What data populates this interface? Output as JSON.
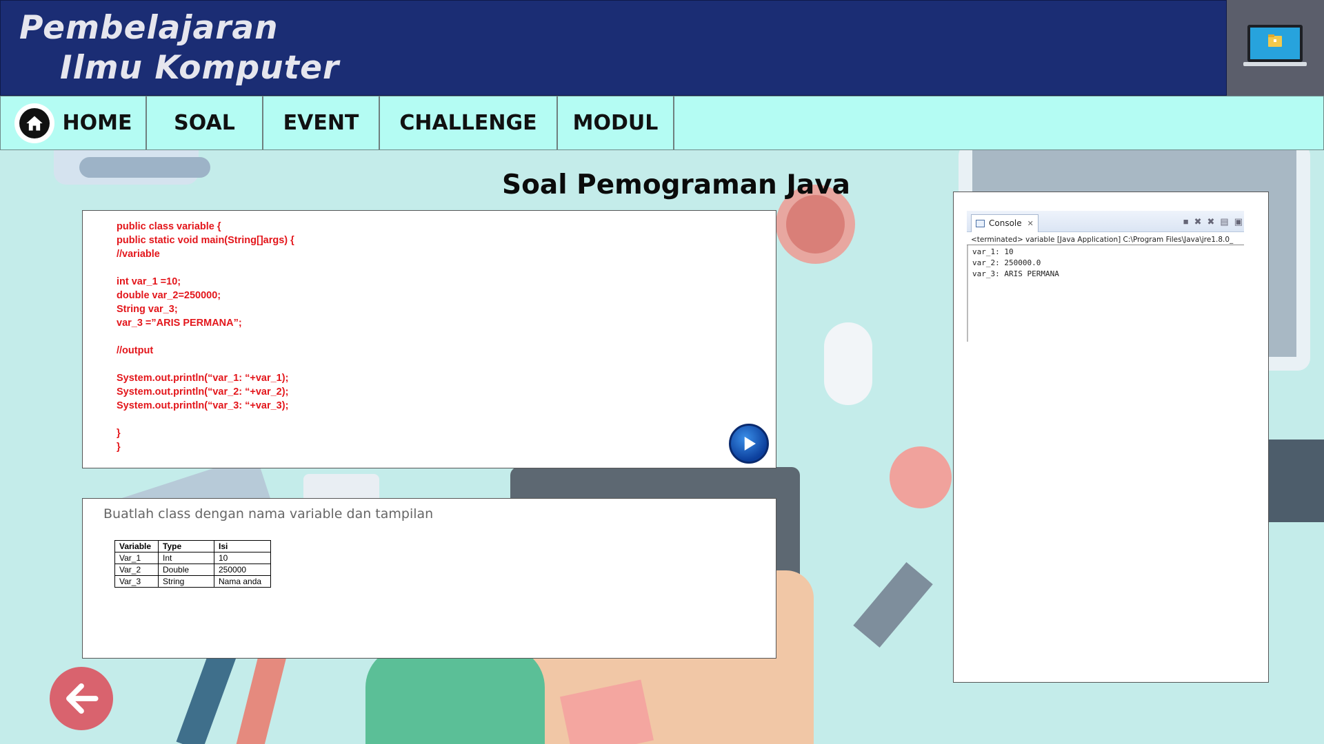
{
  "header": {
    "title_line1": "Pembelajaran",
    "title_line2": "Ilmu Komputer"
  },
  "nav": {
    "items": [
      {
        "label": "HOME"
      },
      {
        "label": "SOAL"
      },
      {
        "label": "EVENT"
      },
      {
        "label": "CHALLENGE"
      },
      {
        "label": "MODUL"
      }
    ]
  },
  "page": {
    "title": "Soal Pemograman Java"
  },
  "code": {
    "lines": [
      "public class variable {",
      "public static void main(String[]args) {",
      "//variable",
      "",
      "int var_1 =10;",
      "double var_2=250000;",
      "String var_3;",
      "var_3 =”ARIS PERMANA”;",
      "",
      "//output",
      "",
      "System.out.println(“var_1: “+var_1);",
      "System.out.println(“var_2: “+var_2);",
      "System.out.println(“var_3: “+var_3);",
      "",
      "}",
      "}"
    ]
  },
  "task": {
    "instruction": "Buatlah class dengan nama variable dan tampilan",
    "table": {
      "headers": [
        "Variable",
        "Type",
        "Isi"
      ],
      "rows": [
        [
          "Var_1",
          "Int",
          "10"
        ],
        [
          "Var_2",
          "Double",
          "250000"
        ],
        [
          "Var_3",
          "String",
          "Nama anda"
        ]
      ]
    }
  },
  "console": {
    "tab_label": "Console",
    "terminated": "<terminated> variable [Java Application] C:\\Program Files\\Java\\jre1.8.0_",
    "output": [
      "var_1: 10",
      "var_2: 250000.0",
      "var_3: ARIS PERMANA"
    ]
  },
  "icons": {
    "home": "home-icon",
    "play": "play-icon",
    "back": "back-arrow-icon",
    "laptop": "laptop-icon"
  },
  "colors": {
    "header_bg": "#1b2d74",
    "nav_bg": "#b4fcf3",
    "code_text": "#e3161b",
    "back_button": "#d9636e"
  }
}
